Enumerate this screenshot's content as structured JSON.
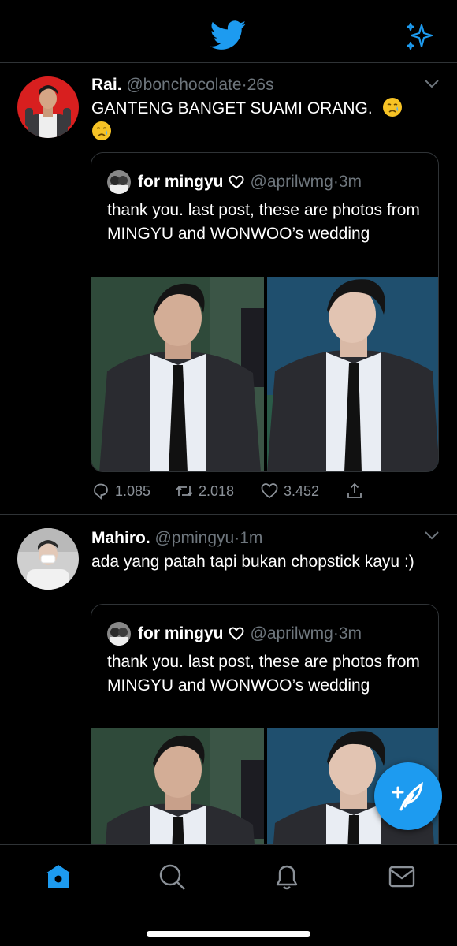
{
  "app": {
    "accent_color": "#1d9bf0",
    "logo_icon": "bird-icon",
    "top_right_icon": "sparkle-icon"
  },
  "tweets": [
    {
      "name": "Rai.",
      "handle": "@bonchocolate",
      "dot": "·",
      "time": "26s",
      "text": "GANTENG BANGET SUAMI ORANG.",
      "emojis": [
        "crying-face",
        "crying-face"
      ],
      "quoted": {
        "name": "for mingyu",
        "handle": "@aprilwmg",
        "dot": "·",
        "time": "3m",
        "text": "thank you. last post, these are photos from MINGYU and WONWOO’s wedding"
      },
      "stats": {
        "replies": "1.085",
        "retweets": "2.018",
        "likes": "3.452"
      }
    },
    {
      "name": "Mahiro.",
      "handle": "@pmingyu",
      "dot": "·",
      "time": "1m",
      "text": "ada yang patah tapi bukan chopstick kayu :)",
      "quoted": {
        "name": "for mingyu",
        "handle": "@aprilwmg",
        "dot": "·",
        "time": "3m",
        "text": "thank you. last post, these are photos from MINGYU and WONWOO’s wedding"
      }
    }
  ],
  "tabbar": {
    "items": [
      "home-icon",
      "search-icon",
      "notifications-icon",
      "messages-icon"
    ],
    "active": "home-icon"
  },
  "compose": {
    "icon": "compose-tweet-icon"
  }
}
